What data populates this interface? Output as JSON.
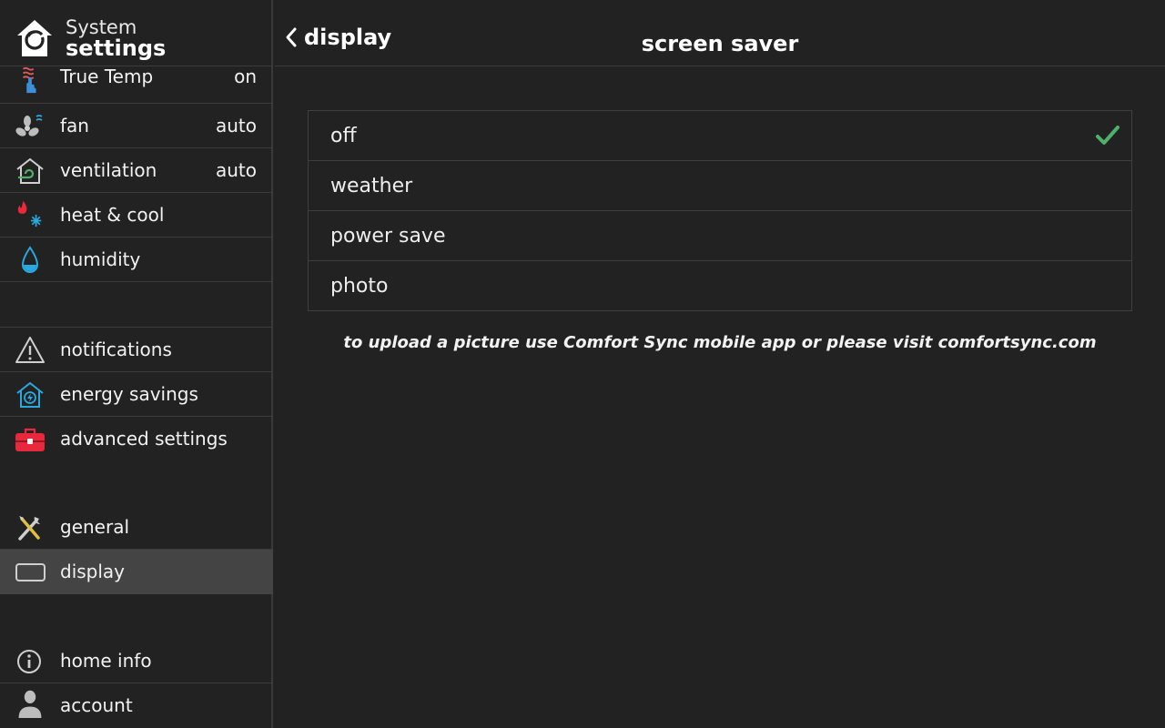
{
  "sidebar": {
    "title_line1": "System",
    "title_line2": "settings",
    "items": [
      {
        "label": "True Temp",
        "value": "on",
        "icon": "true-temp-icon"
      },
      {
        "label": "fan",
        "value": "auto",
        "icon": "fan-icon"
      },
      {
        "label": "ventilation",
        "value": "auto",
        "icon": "ventilation-icon"
      },
      {
        "label": "heat & cool",
        "value": "",
        "icon": "heat-cool-icon"
      },
      {
        "label": "humidity",
        "value": "",
        "icon": "humidity-icon"
      },
      {
        "label": "notifications",
        "value": "",
        "icon": "warning-icon"
      },
      {
        "label": "energy savings",
        "value": "",
        "icon": "energy-house-icon"
      },
      {
        "label": "advanced settings",
        "value": "",
        "icon": "toolbox-icon"
      },
      {
        "label": "general",
        "value": "",
        "icon": "tools-icon"
      },
      {
        "label": "display",
        "value": "",
        "icon": "display-icon"
      },
      {
        "label": "home info",
        "value": "",
        "icon": "info-icon"
      },
      {
        "label": "account",
        "value": "",
        "icon": "person-icon"
      }
    ]
  },
  "header": {
    "back_label": "display",
    "title": "screen saver"
  },
  "options": [
    {
      "label": "off",
      "selected": true
    },
    {
      "label": "weather",
      "selected": false
    },
    {
      "label": "power save",
      "selected": false
    },
    {
      "label": "photo",
      "selected": false
    }
  ],
  "hint": "to upload a picture use Comfort Sync mobile app or please visit comfortsync.com",
  "colors": {
    "background": "#222222",
    "active_item": "#444444",
    "divider": "#3c3c3c",
    "check": "#4fb06b",
    "accent_blue": "#2aa8e0",
    "accent_red": "#e8283c"
  }
}
